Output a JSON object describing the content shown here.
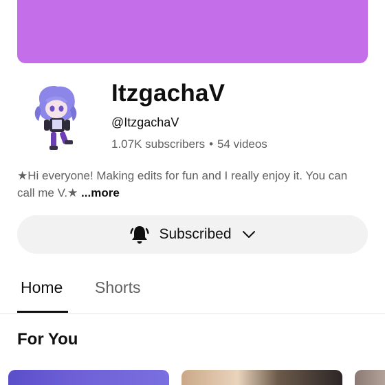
{
  "colors": {
    "banner": "#c56ee9",
    "text_primary": "#0f0f0f",
    "text_secondary": "#606060",
    "button_bg": "#f2f2f2"
  },
  "channel": {
    "name": "ItzgachaV",
    "handle": "@ItzgachaV",
    "subscribers": "1.07K subscribers",
    "separator": "•",
    "videos": "54 videos",
    "description": "★Hi everyone! Making edits for fun and I really enjoy it. You can call me V.★",
    "more_label": "...more"
  },
  "subscribe_button": {
    "label": "Subscribed",
    "icon": "bell-icon",
    "dropdown_icon": "chevron-down-icon"
  },
  "tabs": [
    {
      "label": "Home",
      "selected": true
    },
    {
      "label": "Shorts",
      "selected": false
    }
  ],
  "section": {
    "title": "For You"
  }
}
